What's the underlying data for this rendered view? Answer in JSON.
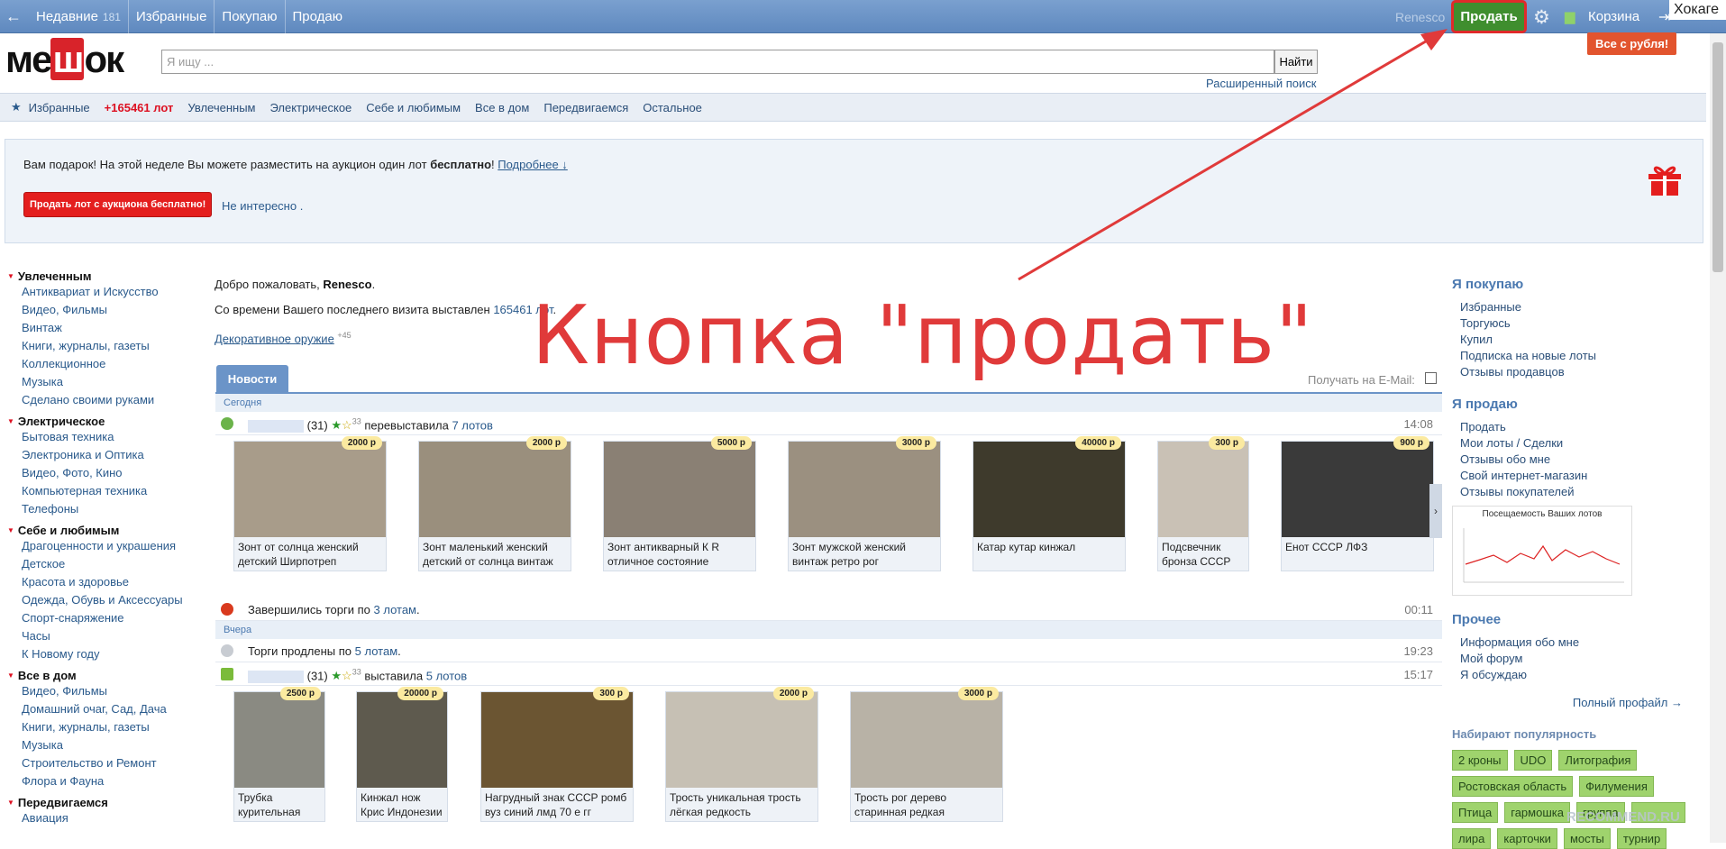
{
  "topbar": {
    "back": "←",
    "recent_label": "Недавние",
    "recent_count": "181",
    "favorites": "Избранные",
    "buying": "Покупаю",
    "selling": "Продаю",
    "username": "Renesco",
    "sell_button": "Продать",
    "cart": "Корзина",
    "corner_text": "Хокаге",
    "all_rub": "Все с рубля!"
  },
  "search": {
    "placeholder": "Я ищу ...",
    "button": "Найти",
    "advanced": "Расширенный поиск"
  },
  "catbar": {
    "favorites": "Избранные",
    "new_lots": "+165461 лот",
    "items": [
      "Увлеченным",
      "Электрическое",
      "Себе и любимым",
      "Все в дом",
      "Передвигаемся",
      "Остальное"
    ]
  },
  "gift": {
    "text_pre": "Вам подарок! На этой неделе Вы можете разместить на аукцион один лот ",
    "text_bold": "бесплатно",
    "text_post": "! ",
    "more": "Подробнее ↓",
    "button": "Продать лот с аукциона бесплатно!",
    "not_interested": "Не интересно ."
  },
  "left": {
    "g1": {
      "title": "Увлеченным",
      "items": [
        "Антиквариат и Искусство",
        "Видео, Фильмы",
        "Винтаж",
        "Книги, журналы, газеты",
        "Коллекционное",
        "Музыка",
        "Сделано своими руками"
      ]
    },
    "g2": {
      "title": "Электрическое",
      "items": [
        "Бытовая техника",
        "Электроника и Оптика",
        "Видео, Фото, Кино",
        "Компьютерная техника",
        "Телефоны"
      ]
    },
    "g3": {
      "title": "Себе и любимым",
      "items": [
        "Драгоценности и украшения",
        "Детское",
        "Красота и здоровье",
        "Одежда, Обувь и Аксессуары",
        "Спорт-снаряжение",
        "Часы",
        "К Новому году"
      ]
    },
    "g4": {
      "title": "Все в дом",
      "items": [
        "Видео, Фильмы",
        "Домашний очаг, Сад, Дача",
        "Книги, журналы, газеты",
        "Музыка",
        "Строительство и Ремонт",
        "Флора и Фауна"
      ]
    },
    "g5": {
      "title": "Передвигаемся",
      "items": [
        "Авиация"
      ]
    }
  },
  "main": {
    "welcome_pre": "Добро пожаловать, ",
    "welcome_name": "Renesco",
    "welcome_post": ".",
    "since_pre": "Со времени Вашего последнего визита выставлен ",
    "since_link": "165461 лот",
    "since_post": ".",
    "deco": "Декоративное оружие",
    "deco_count": "+45",
    "news_tab": "Новости",
    "email_label": "Получать на E-Mail:"
  },
  "overlay": "Кнопка \"продать\"",
  "feed": {
    "today": "Сегодня",
    "yesterday": "Вчера",
    "ev1": {
      "count": "(31)",
      "stars": "33",
      "action": "перевыставила",
      "link": "7 лотов",
      "time": "14:08"
    },
    "ev2": {
      "text": "Завершились торги по ",
      "link": "3 лотам",
      "post": ".",
      "time": "00:11"
    },
    "ev3": {
      "text": "Торги продлены по ",
      "link": "5 лотам",
      "post": ".",
      "time": "19:23"
    },
    "ev4": {
      "count": "(31)",
      "stars": "33",
      "action": "выставила",
      "link": "5 лотов",
      "time": "15:17"
    },
    "lots1": [
      {
        "price": "2000 р",
        "title": "Зонт от солнца женский детский Ширпотреп"
      },
      {
        "price": "2000 р",
        "title": "Зонт маленький женский детский от солнца винтаж"
      },
      {
        "price": "5000 р",
        "title": "Зонт антикварный К R отличное состояние"
      },
      {
        "price": "3000 р",
        "title": "Зонт мужской женский винтаж ретро рог"
      },
      {
        "price": "40000 р",
        "title": "Катар кутар кинжал"
      },
      {
        "price": "300 р",
        "title": "Подсвечник бронза СССР"
      },
      {
        "price": "900 р",
        "title": "Енот СССР ЛФЗ"
      }
    ],
    "lots2": [
      {
        "price": "2500 р",
        "title": "Трубка курительная"
      },
      {
        "price": "20000 р",
        "title": "Кинжал нож Крис Индонезии"
      },
      {
        "price": "300 р",
        "title": "Нагрудный знак СССР ромб вуз синий лмд 70 е гг"
      },
      {
        "price": "2000 р",
        "title": "Трость уникальная трость лёгкая редкость"
      },
      {
        "price": "3000 р",
        "title": "Трость рог дерево старинная редкая"
      }
    ]
  },
  "right": {
    "buy_title": "Я покупаю",
    "buy_items": [
      "Избранные",
      "Торгуюсь",
      "Купил",
      "Подписка на новые лоты",
      "Отзывы продавцов"
    ],
    "sell_title": "Я продаю",
    "sell_items": [
      "Продать",
      "Мои лоты / Сделки",
      "Отзывы обо мне",
      "Свой интернет-магазин",
      "Отзывы покупателей"
    ],
    "graph_title": "Посещаемость Ваших лотов",
    "other_title": "Прочее",
    "other_items": [
      "Информация обо мне",
      "Мой форум",
      "Я обсуждаю"
    ],
    "full_profile": "Полный профайл →",
    "popular_title": "Набирают популярность",
    "tags": [
      "2 кроны",
      "UDO",
      "Литография",
      "Ростовская область",
      "Филумения",
      "Птица",
      "гармошка",
      "группа",
      "",
      "лира",
      "карточки",
      "мосты",
      "турнир"
    ]
  },
  "watermark": "RECOMMEND.RU"
}
